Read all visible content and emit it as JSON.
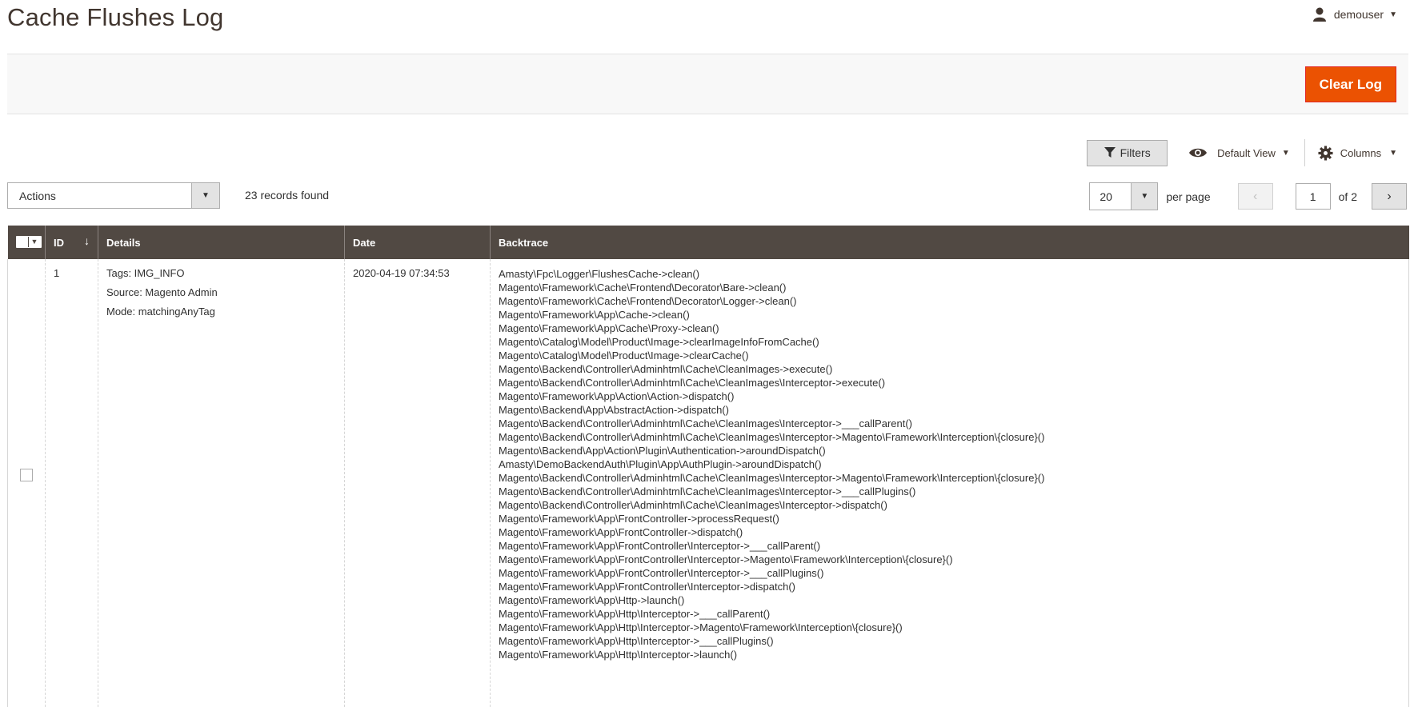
{
  "page": {
    "title": "Cache Flushes Log"
  },
  "user": {
    "name": "demouser"
  },
  "action_bar": {
    "clear_label": "Clear Log"
  },
  "controls": {
    "filters_label": "Filters",
    "view_label": "Default View",
    "columns_label": "Columns"
  },
  "actions": {
    "label": "Actions"
  },
  "records_found": "23 records found",
  "pager": {
    "per_page_value": "20",
    "per_page_label": "per page",
    "current_page": "1",
    "of_pages": "of 2"
  },
  "table": {
    "headers": {
      "id": "ID",
      "details": "Details",
      "date": "Date",
      "backtrace": "Backtrace"
    },
    "rows": [
      {
        "id": "1",
        "details": [
          "Tags: IMG_INFO",
          "Source: Magento Admin",
          "Mode: matchingAnyTag"
        ],
        "date": "2020-04-19 07:34:53",
        "backtrace": [
          "Amasty\\Fpc\\Logger\\FlushesCache->clean()",
          "Magento\\Framework\\Cache\\Frontend\\Decorator\\Bare->clean()",
          "Magento\\Framework\\Cache\\Frontend\\Decorator\\Logger->clean()",
          "Magento\\Framework\\App\\Cache->clean()",
          "Magento\\Framework\\App\\Cache\\Proxy->clean()",
          "Magento\\Catalog\\Model\\Product\\Image->clearImageInfoFromCache()",
          "Magento\\Catalog\\Model\\Product\\Image->clearCache()",
          "Magento\\Backend\\Controller\\Adminhtml\\Cache\\CleanImages->execute()",
          "Magento\\Backend\\Controller\\Adminhtml\\Cache\\CleanImages\\Interceptor->execute()",
          "Magento\\Framework\\App\\Action\\Action->dispatch()",
          "Magento\\Backend\\App\\AbstractAction->dispatch()",
          "Magento\\Backend\\Controller\\Adminhtml\\Cache\\CleanImages\\Interceptor->___callParent()",
          "Magento\\Backend\\Controller\\Adminhtml\\Cache\\CleanImages\\Interceptor->Magento\\Framework\\Interception\\{closure}()",
          "Magento\\Backend\\App\\Action\\Plugin\\Authentication->aroundDispatch()",
          "Amasty\\DemoBackendAuth\\Plugin\\App\\AuthPlugin->aroundDispatch()",
          "Magento\\Backend\\Controller\\Adminhtml\\Cache\\CleanImages\\Interceptor->Magento\\Framework\\Interception\\{closure}()",
          "Magento\\Backend\\Controller\\Adminhtml\\Cache\\CleanImages\\Interceptor->___callPlugins()",
          "Magento\\Backend\\Controller\\Adminhtml\\Cache\\CleanImages\\Interceptor->dispatch()",
          "Magento\\Framework\\App\\FrontController->processRequest()",
          "Magento\\Framework\\App\\FrontController->dispatch()",
          "Magento\\Framework\\App\\FrontController\\Interceptor->___callParent()",
          "Magento\\Framework\\App\\FrontController\\Interceptor->Magento\\Framework\\Interception\\{closure}()",
          "Magento\\Framework\\App\\FrontController\\Interceptor->___callPlugins()",
          "Magento\\Framework\\App\\FrontController\\Interceptor->dispatch()",
          "Magento\\Framework\\App\\Http->launch()",
          "Magento\\Framework\\App\\Http\\Interceptor->___callParent()",
          "Magento\\Framework\\App\\Http\\Interceptor->Magento\\Framework\\Interception\\{closure}()",
          "Magento\\Framework\\App\\Http\\Interceptor->___callPlugins()",
          "Magento\\Framework\\App\\Http\\Interceptor->launch()"
        ]
      }
    ]
  },
  "icons": {
    "user": "user-icon",
    "filter": "filter-icon",
    "view": "eye-icon",
    "columns": "gear-icon",
    "sort": "sort-arrow-icon"
  },
  "colors": {
    "accent": "#eb5202",
    "header_bg": "#514943",
    "title": "#41362f"
  }
}
